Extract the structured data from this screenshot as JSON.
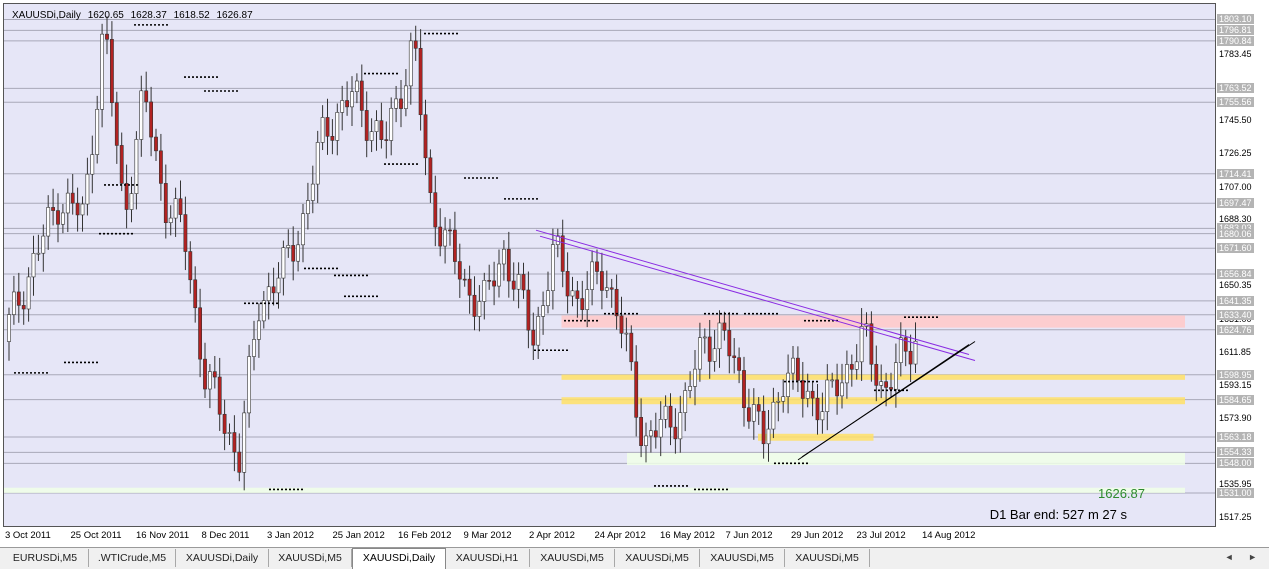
{
  "symbol_header": {
    "name": "XAUUSDi,Daily",
    "open": "1620.65",
    "high": "1628.37",
    "low": "1618.52",
    "close": "1626.87"
  },
  "current_price_label": "1626.87",
  "bar_end_label": "D1 Bar end: 527 m 27 s",
  "colors": {
    "background": "#e6e6f7",
    "bull_candle": "#ffffff",
    "bear_candle": "#b22222",
    "trendline": "#8a2be2",
    "support_line": "#000000",
    "yellow_zone": "#ffe066",
    "pink_zone": "#ffc8c8",
    "green_zone": "#f0ffe8",
    "price_text": "#2e8b2e"
  },
  "y_axis_ticks": [
    "1783.45",
    "1745.50",
    "1726.25",
    "1707.00",
    "1688.30",
    "1650.35",
    "1631.00",
    "1611.85",
    "1593.15",
    "1573.90",
    "1535.95",
    "1517.25"
  ],
  "y_axis_levels": [
    "1803.10",
    "1796.81",
    "1790.84",
    "1763.52",
    "1755.56",
    "1714.41",
    "1697.47",
    "1683.03",
    "1680.06",
    "1671.60",
    "1656.84",
    "1641.35",
    "1633.40",
    "1624.76",
    "1598.95",
    "1584.65",
    "1563.18",
    "1554.33",
    "1548.00",
    "1531.00"
  ],
  "x_axis_labels": [
    "3 Oct 2011",
    "25 Oct 2011",
    "16 Nov 2011",
    "8 Dec 2011",
    "3 Jan 2012",
    "25 Jan 2012",
    "16 Feb 2012",
    "9 Mar 2012",
    "2 Apr 2012",
    "24 Apr 2012",
    "16 May 2012",
    "7 Jun 2012",
    "29 Jun 2012",
    "23 Jul 2012",
    "14 Aug 2012"
  ],
  "chart_data": {
    "type": "candlestick",
    "title": "XAUUSDi,Daily",
    "ylim": [
      1512,
      1812
    ],
    "horizontal_levels": [
      1803.1,
      1796.81,
      1790.84,
      1763.52,
      1755.56,
      1714.41,
      1697.47,
      1683.03,
      1680.06,
      1671.6,
      1656.84,
      1641.35,
      1633.4,
      1624.76,
      1598.95,
      1584.65,
      1563.18,
      1554.33,
      1548.0,
      1531.0
    ],
    "zones": [
      {
        "color": "pink",
        "from_date": "24 Apr 2012",
        "to_date": "after 14 Aug 2012",
        "low": 1626,
        "high": 1633
      },
      {
        "color": "yellow",
        "from_date": "24 Apr 2012",
        "to_date": "after 14 Aug 2012",
        "low": 1596,
        "high": 1599
      },
      {
        "color": "yellow",
        "from_date": "24 Apr 2012",
        "to_date": "after 14 Aug 2012",
        "low": 1582,
        "high": 1586
      },
      {
        "color": "yellow",
        "from_date": "29 Jun 2012",
        "to_date": "23 Jul 2012",
        "low": 1561,
        "high": 1565
      },
      {
        "color": "green",
        "from_date": "16 May 2012",
        "to_date": "after 14 Aug 2012",
        "low": 1547,
        "high": 1554
      },
      {
        "color": "green",
        "from_date": "3 Oct 2011",
        "to_date": "after 14 Aug 2012",
        "low": 1531,
        "high": 1534
      }
    ],
    "trendlines": [
      {
        "name": "resistance",
        "from": [
          "2 Apr 2012",
          1682
        ],
        "to": [
          "14 Aug 2012",
          1614
        ]
      },
      {
        "name": "support",
        "from": [
          "29 Jun 2012",
          1550
        ],
        "to": [
          "14 Aug 2012",
          1614
        ]
      }
    ],
    "last_close": 1626.87
  },
  "tabs": [
    {
      "label": "EURUSDi,M5"
    },
    {
      "label": ".WTICrude,M5"
    },
    {
      "label": "XAUUSDi,Daily"
    },
    {
      "label": "XAUUSDi,M5"
    },
    {
      "label": "XAUUSDi,Daily"
    },
    {
      "label": "XAUUSDi,H1"
    },
    {
      "label": "XAUUSDi,M5"
    },
    {
      "label": "XAUUSDi,M5"
    },
    {
      "label": "XAUUSDi,M5"
    },
    {
      "label": "XAUUSDi,M5"
    }
  ],
  "active_tab": 4,
  "tab_scroll_arrows": "◄ ►"
}
